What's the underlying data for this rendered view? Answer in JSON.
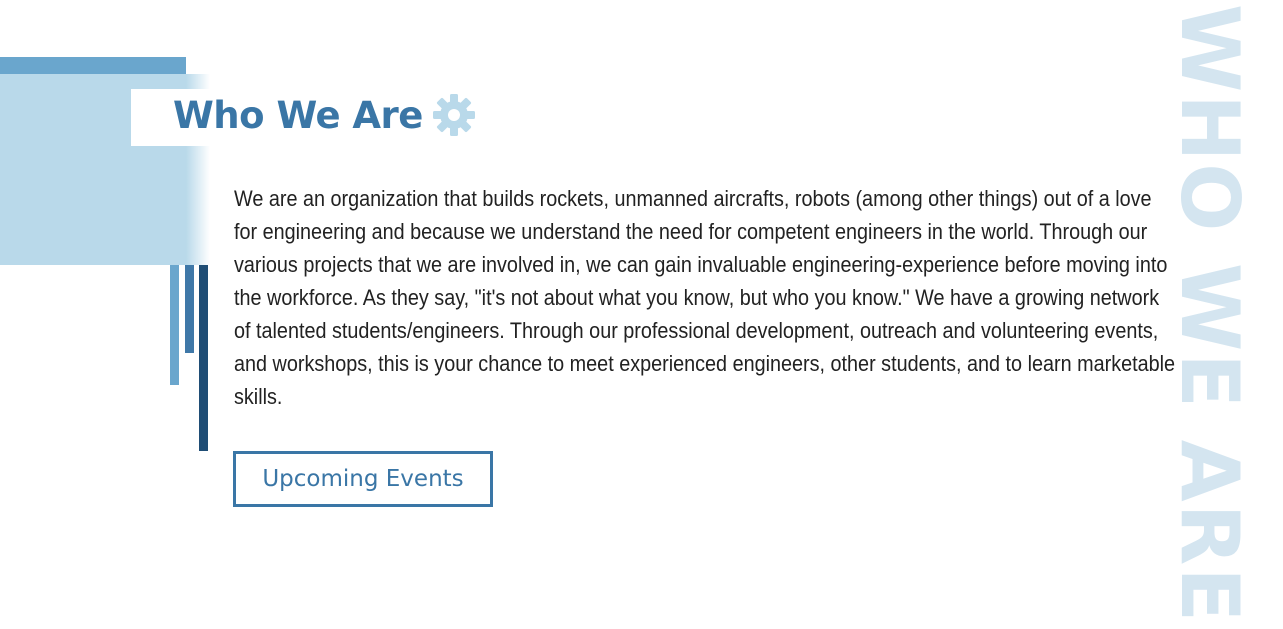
{
  "section": {
    "title": "Who We Are",
    "title_icon": "gear-icon",
    "watermark": "WHO WE ARE",
    "body": "We are an organization that builds rockets, unmanned aircrafts, robots (among other things) out of a love for engineering and because we understand the need for competent engineers in the world. Through our various projects that we are involved in, we can gain invaluable engineering-experience before moving into the workforce. As they say, \"it's not about what you know, but who you know.\" We have a growing network of talented students/engineers. Through our professional development, outreach and volunteering events, and workshops, this is your chance to meet experienced engineers, other students, and to learn marketable skills.",
    "cta_label": "Upcoming Events"
  },
  "colors": {
    "accent": "#3a76a6",
    "light_blue": "#b9d9ea",
    "mid_blue": "#6aa6cd",
    "dark_blue": "#1f4d75",
    "watermark": "#d4e5f0"
  }
}
